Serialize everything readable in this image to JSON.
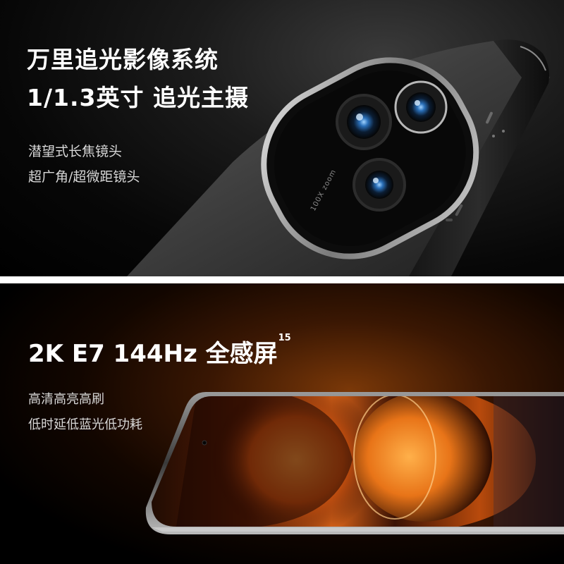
{
  "camera": {
    "headline_1": "万里追光影像系统",
    "headline_2": "1/1.3英寸 追光主摄",
    "feature_1": "潜望式长焦镜头",
    "feature_2": "超广角/超微距镜头",
    "lens_marking": "100X zoom"
  },
  "display": {
    "headline": "2K E7 144Hz  全感屏",
    "footnote": "15",
    "feature_1": "高清高亮高刷",
    "feature_2": "低时延低蓝光低功耗"
  }
}
